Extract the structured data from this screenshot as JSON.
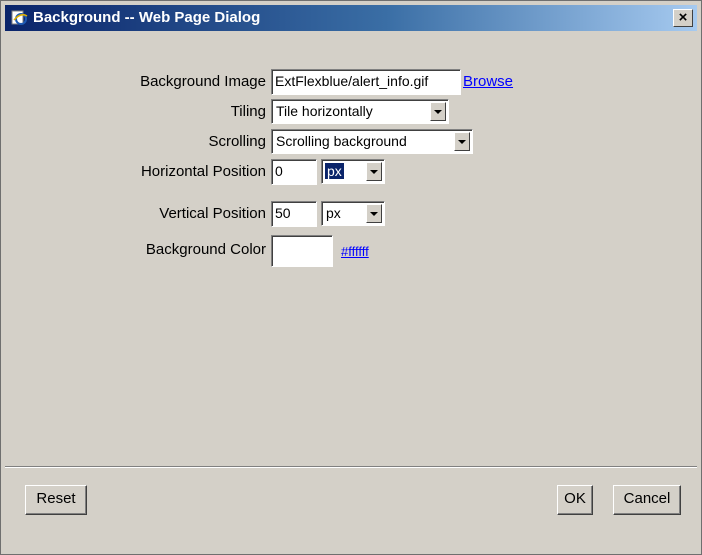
{
  "window": {
    "title": "Background -- Web Page Dialog",
    "close_glyph": "×"
  },
  "form": {
    "background_image": {
      "label": "Background Image",
      "value": "ExtFlexblue/alert_info.gif",
      "browse_label": "Browse"
    },
    "tiling": {
      "label": "Tiling",
      "value": "Tile horizontally"
    },
    "scrolling": {
      "label": "Scrolling",
      "value": "Scrolling background"
    },
    "horizontal_position": {
      "label": "Horizontal Position",
      "value": "0",
      "unit": "px"
    },
    "vertical_position": {
      "label": "Vertical Position",
      "value": "50",
      "unit": "px"
    },
    "background_color": {
      "label": "Background Color",
      "value": "",
      "link": "#ffffff"
    }
  },
  "buttons": {
    "reset": "Reset",
    "ok": "OK",
    "cancel": "Cancel"
  },
  "colors": {
    "dialog_bg": "#d4d0c8",
    "title_start": "#0a246a",
    "title_end": "#a6caf0",
    "link": "#0000ff",
    "highlight": "#0a246a"
  },
  "icons": {
    "title_icon": "ie-page-icon",
    "dropdown": "chevron-down-icon"
  }
}
